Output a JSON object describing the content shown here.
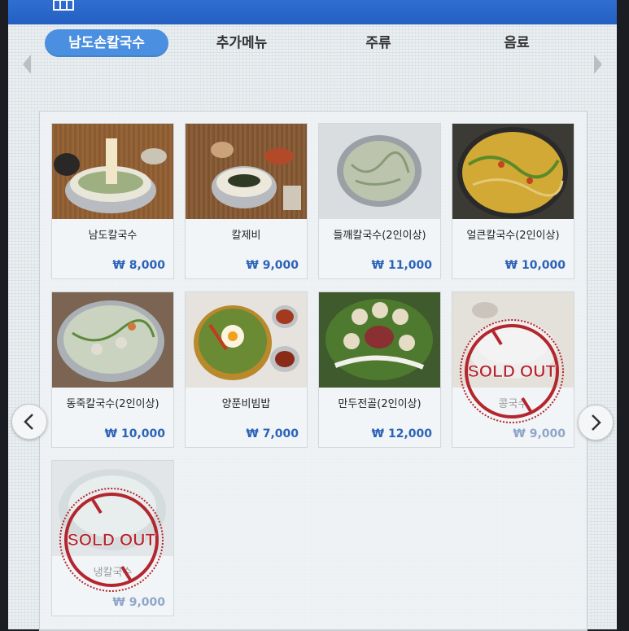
{
  "tabs": [
    {
      "label": "남도손칼국수",
      "active": true
    },
    {
      "label": "추가메뉴",
      "active": false
    },
    {
      "label": "주류",
      "active": false
    },
    {
      "label": "음료",
      "active": false
    }
  ],
  "items": [
    {
      "name": "남도칼국수",
      "price": "₩ 8,000",
      "sold_out": false
    },
    {
      "name": "칼제비",
      "price": "₩ 9,000",
      "sold_out": false
    },
    {
      "name": "들깨칼국수(2인이상)",
      "price": "₩ 11,000",
      "sold_out": false
    },
    {
      "name": "얼큰칼국수(2인이상)",
      "price": "₩ 10,000",
      "sold_out": false
    },
    {
      "name": "동죽칼국수(2인이상)",
      "price": "₩ 10,000",
      "sold_out": false
    },
    {
      "name": "양푼비빔밥",
      "price": "₩ 7,000",
      "sold_out": false
    },
    {
      "name": "만두전골(2인이상)",
      "price": "₩ 12,000",
      "sold_out": false
    },
    {
      "name": "콩국수",
      "price": "₩ 9,000",
      "sold_out": true
    },
    {
      "name": "냉칼국수",
      "price": "₩ 9,000",
      "sold_out": true
    }
  ],
  "sold_out_label": "SOLD OUT",
  "colors": {
    "topbar": "#2f6fd1",
    "active_tab": "#4a8fe0",
    "price": "#2c63b8",
    "stamp": "#b3262e"
  }
}
